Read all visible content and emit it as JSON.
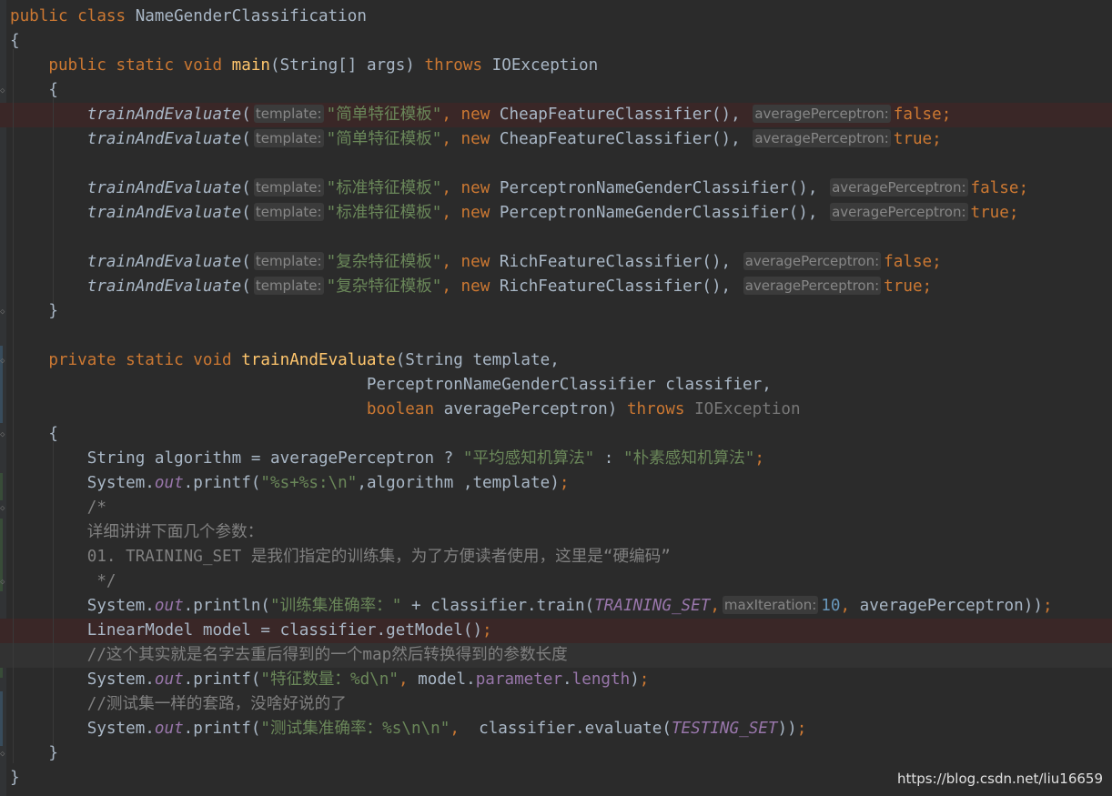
{
  "watermark": "https://blog.csdn.net/liu16659",
  "hint_template": "template:",
  "hint_average": "averagePerceptron:",
  "hint_max": "maxIteration:",
  "code": {
    "class_decl": "NameGenderClassification",
    "main_name": "main",
    "main_params": "(String[] args) ",
    "throws": "throws",
    "ioexception": " IOException",
    "call_fn": "trainAndEvaluate",
    "tpl_simple": "\"简单特征模板\"",
    "tpl_standard": "\"标准特征模板\"",
    "tpl_complex": "\"复杂特征模板\"",
    "cls_cheap": " CheapFeatureClassifier(), ",
    "cls_perceptron": " PerceptronNameGenderClassifier(), ",
    "cls_rich": " RichFeatureClassifier(), ",
    "t_false": "false",
    "t_true": "true",
    "method_p1": "(String template,",
    "method_p2": "PerceptronNameGenderClassifier classifier,",
    "method_p3b": " averagePerceptron) ",
    "algo_a": "String algorithm = averagePerceptron ? ",
    "algo_s1": "\"平均感知机算法\"",
    "algo_s2": "\"朴素感知机算法\"",
    "printf1_fmt": "\"%s+%s:\\n\"",
    "printf1_args": ",algorithm ,template)",
    "comment_open": "/*",
    "comment_l1": "详细讲讲下面几个参数：",
    "comment_l2": "01. TRAINING_SET 是我们指定的训练集，为了方便读者使用，这里是“硬编码”",
    "comment_close": " */",
    "println_str": "\"训练集准确率：\"",
    "println_mid": " + classifier.train(",
    "training_set": "TRAINING_SET",
    "iter_value": "10",
    "println_end": " averagePerceptron))",
    "model_line": "LinearModel model = classifier.getModel()",
    "comment2": "//这个其实就是名字去重后得到的一个map然后转换得到的参数长度",
    "printf2_str": "\"特征数量：%d\\n\"",
    "printf2_mid": " model.",
    "field_parameter": "parameter",
    "field_length": "length",
    "comment3": "//测试集一样的套路，没啥好说的了",
    "printf3_str": "\"测试集准确率：%s\\n\\n\"",
    "printf3_mid": "  classifier.evaluate(",
    "testing_set": "TESTING_SET"
  }
}
